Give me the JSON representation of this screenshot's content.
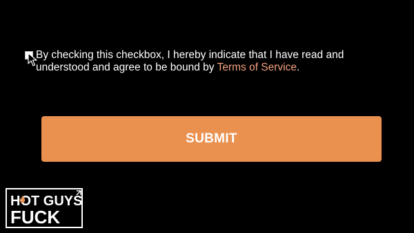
{
  "consent": {
    "text_before": "By checking this checkbox, I hereby indicate that I have read and understood and agree to be bound by ",
    "terms_link": "Terms of Service",
    "text_after": "."
  },
  "submit": {
    "label": "SUBMIT"
  },
  "watermark": {
    "line1": "HOT GUYS",
    "line2": "FUCK"
  },
  "colors": {
    "background": "#000000",
    "accent": "#ea9150",
    "link": "#f4a27f",
    "text": "#ffffff"
  },
  "icons": {
    "pointer": "mouse-pointer-icon",
    "flame": "flame-icon"
  }
}
